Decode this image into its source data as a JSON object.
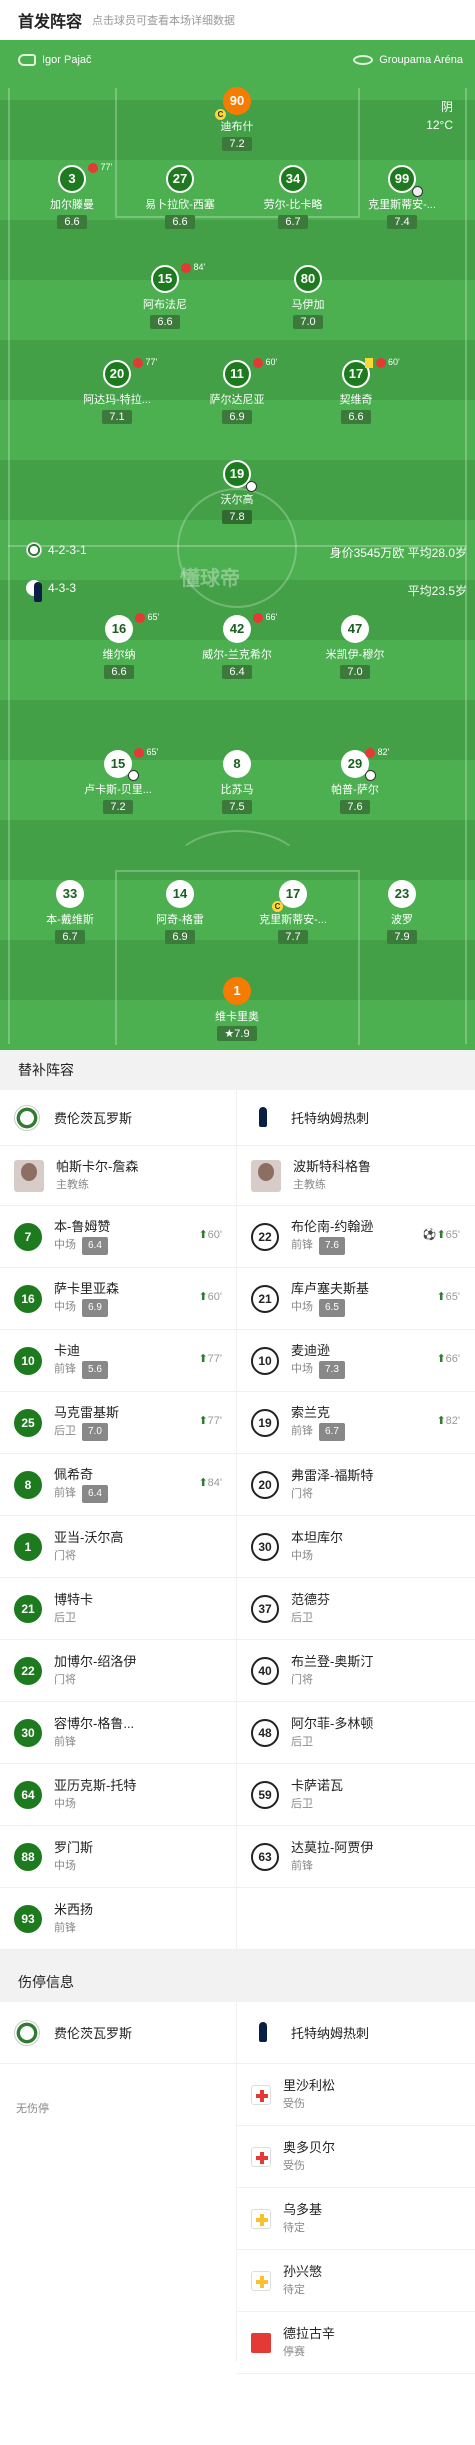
{
  "header": {
    "title": "首发阵容",
    "subtitle": "点击球员可查看本场详细数据"
  },
  "pitch": {
    "home_coach": "Igor Pajač",
    "stadium": "Groupama Aréna",
    "weather": "阴",
    "temperature": "12°C",
    "watermark": "懂球帝",
    "home_formation": "4-2-3-1",
    "home_value": "身价3545万欧 平均28.0岁",
    "away_formation": "4-3-3",
    "away_age": "平均23.5岁"
  },
  "home_players": [
    {
      "num": "90",
      "name": "迪布什",
      "rating": "7.2"
    },
    {
      "num": "3",
      "name": "加尔滕曼",
      "rating": "6.6",
      "sub": "77'"
    },
    {
      "num": "27",
      "name": "易卜拉欣-西塞",
      "rating": "6.6"
    },
    {
      "num": "34",
      "name": "劳尔-比卡略",
      "rating": "6.7"
    },
    {
      "num": "99",
      "name": "克里斯蒂安-...",
      "rating": "7.4"
    },
    {
      "num": "15",
      "name": "阿布法尼",
      "rating": "6.6",
      "sub": "84'"
    },
    {
      "num": "80",
      "name": "马伊加",
      "rating": "7.0"
    },
    {
      "num": "20",
      "name": "阿达玛-特拉...",
      "rating": "7.1",
      "sub": "77'"
    },
    {
      "num": "11",
      "name": "萨尔达尼亚",
      "rating": "6.9",
      "sub": "60'"
    },
    {
      "num": "17",
      "name": "契维奇",
      "rating": "6.6",
      "sub": "60'"
    },
    {
      "num": "19",
      "name": "沃尔高",
      "rating": "7.8"
    }
  ],
  "away_players": [
    {
      "num": "16",
      "name": "维尔纳",
      "rating": "6.6",
      "sub": "65'"
    },
    {
      "num": "42",
      "name": "威尔-兰克希尔",
      "rating": "6.4",
      "sub": "66'"
    },
    {
      "num": "47",
      "name": "米凯伊-穆尔",
      "rating": "7.0"
    },
    {
      "num": "15",
      "name": "卢卡斯-贝里...",
      "rating": "7.2",
      "sub": "65'"
    },
    {
      "num": "8",
      "name": "比苏马",
      "rating": "7.5"
    },
    {
      "num": "29",
      "name": "帕普-萨尔",
      "rating": "7.6",
      "sub": "82'"
    },
    {
      "num": "33",
      "name": "本-戴维斯",
      "rating": "6.7"
    },
    {
      "num": "14",
      "name": "阿奇-格雷",
      "rating": "6.9"
    },
    {
      "num": "17",
      "name": "克里斯蒂安-...",
      "rating": "7.7"
    },
    {
      "num": "23",
      "name": "波罗",
      "rating": "7.9"
    },
    {
      "num": "1",
      "name": "维卡里奥",
      "rating": "7.9"
    }
  ],
  "subs": {
    "title": "替补阵容",
    "home_team": "费伦茨瓦罗斯",
    "away_team": "托特纳姆热刺",
    "coach_label": "主教练",
    "home_coach": "帕斯卡尔-詹森",
    "away_coach": "波斯特科格鲁",
    "home": [
      {
        "num": "7",
        "name": "本-鲁姆赞",
        "pos": "中场",
        "rating": "6.4",
        "minute": "60'"
      },
      {
        "num": "16",
        "name": "萨卡里亚森",
        "pos": "中场",
        "rating": "6.9",
        "minute": "60'"
      },
      {
        "num": "10",
        "name": "卡迪",
        "pos": "前锋",
        "rating": "5.6",
        "minute": "77'"
      },
      {
        "num": "25",
        "name": "马克雷基斯",
        "pos": "后卫",
        "rating": "7.0",
        "minute": "77'"
      },
      {
        "num": "8",
        "name": "佩希奇",
        "pos": "前锋",
        "rating": "6.4",
        "minute": "84'"
      },
      {
        "num": "1",
        "name": "亚当-沃尔高",
        "pos": "门将"
      },
      {
        "num": "21",
        "name": "博特卡",
        "pos": "后卫"
      },
      {
        "num": "22",
        "name": "加博尔-绍洛伊",
        "pos": "门将"
      },
      {
        "num": "30",
        "name": "容博尔-格鲁...",
        "pos": "前锋"
      },
      {
        "num": "64",
        "name": "亚历克斯-托特",
        "pos": "中场"
      },
      {
        "num": "88",
        "name": "罗门斯",
        "pos": "中场"
      },
      {
        "num": "93",
        "name": "米西扬",
        "pos": "前锋"
      }
    ],
    "away": [
      {
        "num": "22",
        "name": "布伦南-约翰逊",
        "pos": "前锋",
        "rating": "7.6",
        "minute": "65'"
      },
      {
        "num": "21",
        "name": "库卢塞夫斯基",
        "pos": "中场",
        "rating": "6.5",
        "minute": "65'"
      },
      {
        "num": "10",
        "name": "麦迪逊",
        "pos": "中场",
        "rating": "7.3",
        "minute": "66'"
      },
      {
        "num": "19",
        "name": "索兰克",
        "pos": "前锋",
        "rating": "6.7",
        "minute": "82'"
      },
      {
        "num": "20",
        "name": "弗雷泽-福斯特",
        "pos": "门将"
      },
      {
        "num": "30",
        "name": "本坦库尔",
        "pos": "中场"
      },
      {
        "num": "37",
        "name": "范德芬",
        "pos": "后卫"
      },
      {
        "num": "40",
        "name": "布兰登-奥斯汀",
        "pos": "门将"
      },
      {
        "num": "48",
        "name": "阿尔菲-多林顿",
        "pos": "后卫"
      },
      {
        "num": "59",
        "name": "卡萨诺瓦",
        "pos": "后卫"
      },
      {
        "num": "63",
        "name": "达莫拉-阿贾伊",
        "pos": "前锋"
      }
    ]
  },
  "injuries": {
    "title": "伤停信息",
    "home_team": "费伦茨瓦罗斯",
    "away_team": "托特纳姆热刺",
    "none_label": "无伤停",
    "away": [
      {
        "name": "里沙利松",
        "status": "受伤",
        "icon": "red-cross-icon"
      },
      {
        "name": "奥多贝尔",
        "status": "受伤",
        "icon": "red-cross-icon"
      },
      {
        "name": "乌多基",
        "status": "待定",
        "icon": "yellow-cross-icon"
      },
      {
        "name": "孙兴慜",
        "status": "待定",
        "icon": "yellow-cross-icon"
      },
      {
        "name": "德拉古辛",
        "status": "停赛",
        "icon": "red-card-icon"
      }
    ]
  }
}
